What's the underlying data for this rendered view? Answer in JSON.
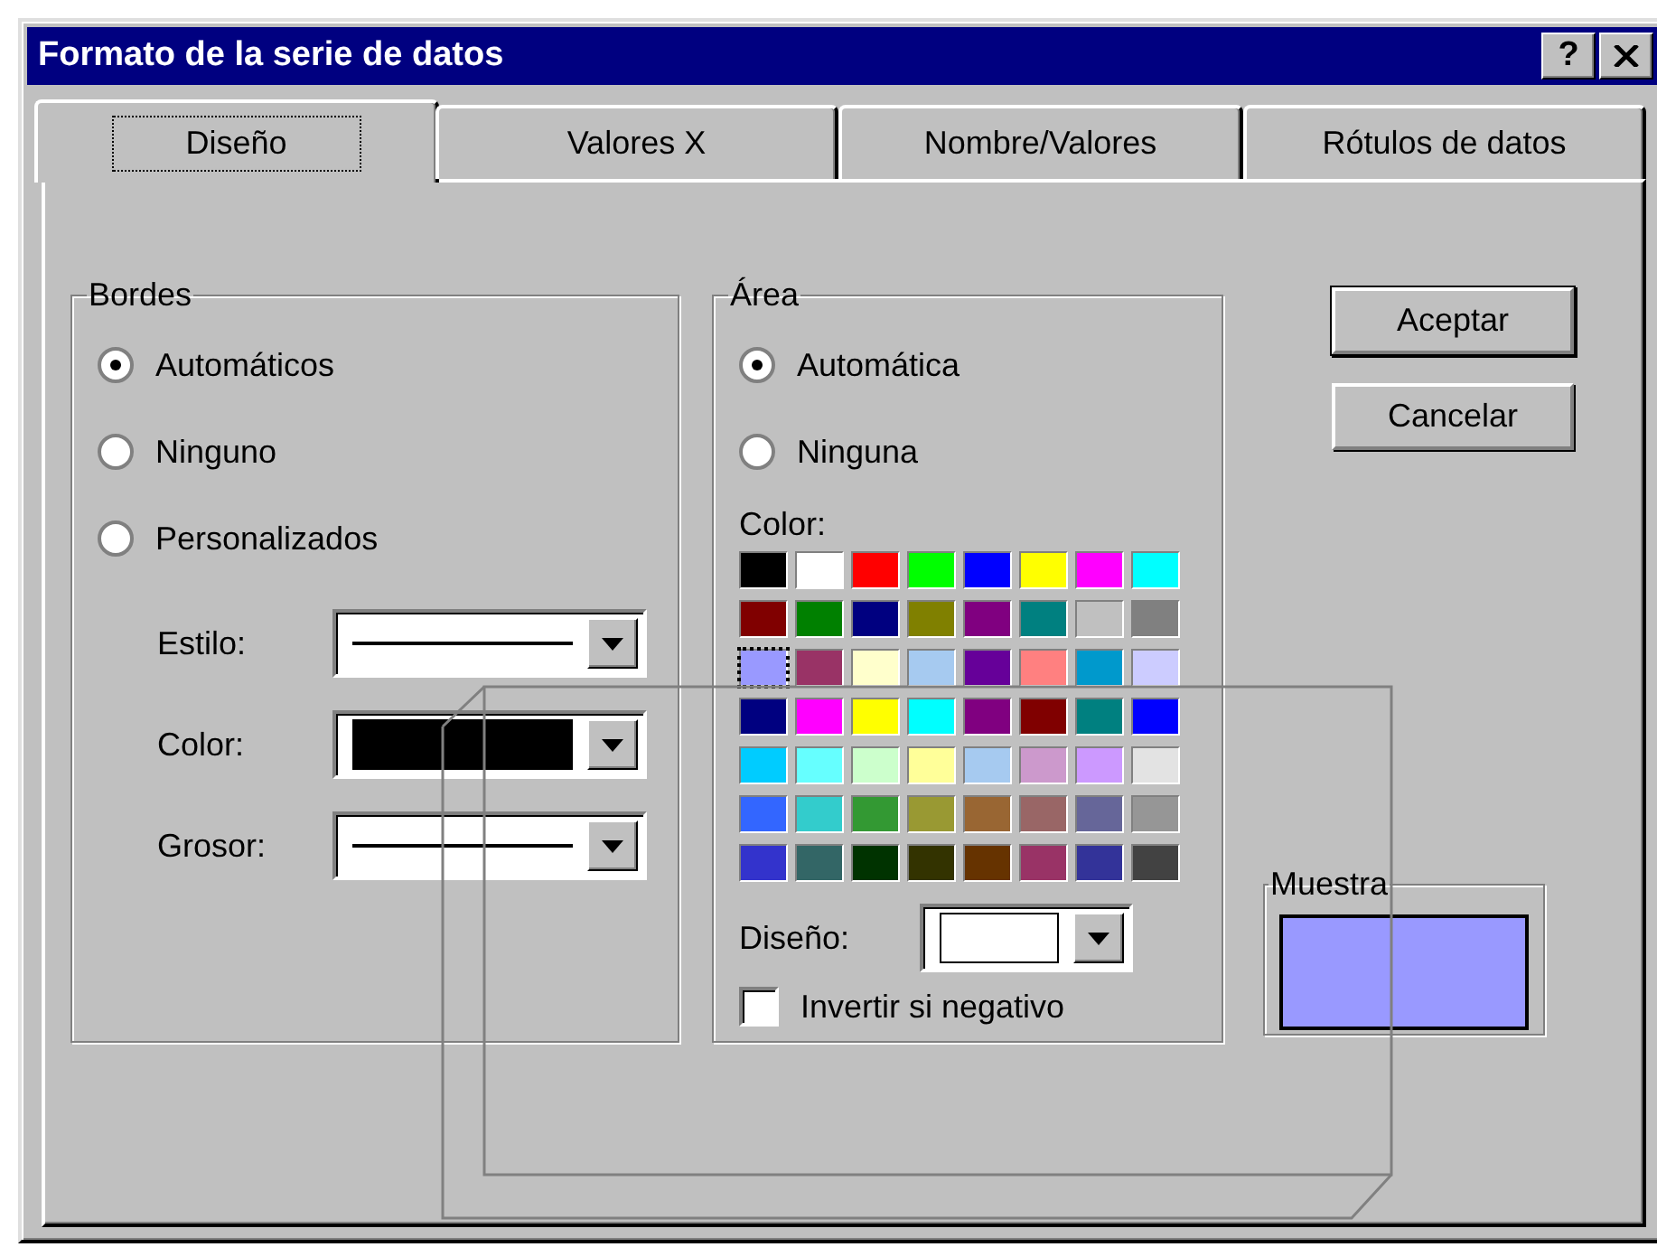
{
  "window": {
    "title": "Formato de la serie de datos",
    "help_button": "?"
  },
  "tabs": [
    {
      "label": "Diseño",
      "selected": true
    },
    {
      "label": "Valores X",
      "selected": false
    },
    {
      "label": "Nombre/Valores",
      "selected": false
    },
    {
      "label": "Rótulos de datos",
      "selected": false
    }
  ],
  "borders": {
    "title": "Bordes",
    "options": [
      {
        "label": "Automáticos",
        "selected": true
      },
      {
        "label": "Ninguno",
        "selected": false
      },
      {
        "label": "Personalizados",
        "selected": false
      }
    ],
    "fields": [
      {
        "label": "Estilo:",
        "kind": "line"
      },
      {
        "label": "Color:",
        "kind": "color",
        "color": "#000000"
      },
      {
        "label": "Grosor:",
        "kind": "line"
      }
    ]
  },
  "area": {
    "title": "Área",
    "options": [
      {
        "label": "Automática",
        "selected": true
      },
      {
        "label": "Ninguna",
        "selected": false
      }
    ],
    "color_label": "Color:",
    "palette": [
      [
        {
          "color": "#000000",
          "selected": false
        },
        {
          "color": "#ffffff",
          "selected": false
        },
        {
          "color": "#ff0000",
          "selected": false
        },
        {
          "color": "#00ff00",
          "selected": false
        },
        {
          "color": "#0000ff",
          "selected": false
        },
        {
          "color": "#ffff00",
          "selected": false
        },
        {
          "color": "#ff00ff",
          "selected": false
        },
        {
          "color": "#00ffff",
          "selected": false
        }
      ],
      [
        {
          "color": "#800000",
          "selected": false
        },
        {
          "color": "#008000",
          "selected": false
        },
        {
          "color": "#000080",
          "selected": false
        },
        {
          "color": "#808000",
          "selected": false
        },
        {
          "color": "#800080",
          "selected": false
        },
        {
          "color": "#008080",
          "selected": false
        },
        {
          "color": "#c0c0c0",
          "selected": false
        },
        {
          "color": "#808080",
          "selected": false
        }
      ],
      [
        {
          "color": "#9999ff",
          "selected": true
        },
        {
          "color": "#993366",
          "selected": false
        },
        {
          "color": "#ffffcc",
          "selected": false
        },
        {
          "color": "#a6caf0",
          "selected": false
        },
        {
          "color": "#660099",
          "selected": false
        },
        {
          "color": "#ff8080",
          "selected": false
        },
        {
          "color": "#0099cc",
          "selected": false
        },
        {
          "color": "#ccccff",
          "selected": false
        }
      ],
      [
        {
          "color": "#000080",
          "selected": false
        },
        {
          "color": "#ff00ff",
          "selected": false
        },
        {
          "color": "#ffff00",
          "selected": false
        },
        {
          "color": "#00ffff",
          "selected": false
        },
        {
          "color": "#800080",
          "selected": false
        },
        {
          "color": "#800000",
          "selected": false
        },
        {
          "color": "#008080",
          "selected": false
        },
        {
          "color": "#0000ff",
          "selected": false
        }
      ],
      [
        {
          "color": "#00ccff",
          "selected": false
        },
        {
          "color": "#66ffff",
          "selected": false
        },
        {
          "color": "#ccffcc",
          "selected": false
        },
        {
          "color": "#ffff99",
          "selected": false
        },
        {
          "color": "#a6caf0",
          "selected": false
        },
        {
          "color": "#cc99cc",
          "selected": false
        },
        {
          "color": "#cc99ff",
          "selected": false
        },
        {
          "color": "#e3e3e3",
          "selected": false
        }
      ],
      [
        {
          "color": "#3366ff",
          "selected": false
        },
        {
          "color": "#33cccc",
          "selected": false
        },
        {
          "color": "#339933",
          "selected": false
        },
        {
          "color": "#999933",
          "selected": false
        },
        {
          "color": "#996633",
          "selected": false
        },
        {
          "color": "#996666",
          "selected": false
        },
        {
          "color": "#666699",
          "selected": false
        },
        {
          "color": "#969696",
          "selected": false
        }
      ],
      [
        {
          "color": "#3333cc",
          "selected": false
        },
        {
          "color": "#336666",
          "selected": false
        },
        {
          "color": "#003300",
          "selected": false
        },
        {
          "color": "#333300",
          "selected": false
        },
        {
          "color": "#663300",
          "selected": false
        },
        {
          "color": "#993366",
          "selected": false
        },
        {
          "color": "#333399",
          "selected": false
        },
        {
          "color": "#424242",
          "selected": false
        }
      ]
    ],
    "pattern": {
      "label": "Diseño:",
      "color": "#ffffff"
    },
    "invert_if_negative": {
      "label": "Invertir si negativo",
      "checked": false
    }
  },
  "buttons": [
    {
      "label": "Aceptar",
      "default": true
    },
    {
      "label": "Cancelar",
      "default": false
    }
  ],
  "sample": {
    "title": "Muestra",
    "color": "#9999ff"
  }
}
